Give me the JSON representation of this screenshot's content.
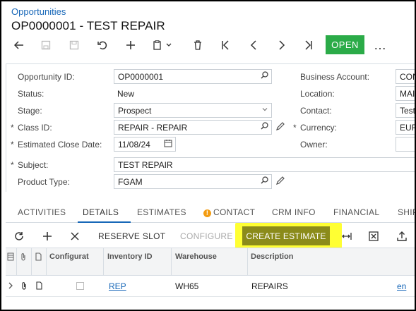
{
  "breadcrumb": "Opportunities",
  "title": "OP0000001 - TEST REPAIR",
  "toolbar": {
    "open_label": "OPEN",
    "more_label": "…"
  },
  "form": {
    "left": [
      {
        "label": "Opportunity ID:",
        "value": "OP0000001"
      },
      {
        "label": "Status:",
        "value": "New"
      },
      {
        "label": "Stage:",
        "value": "Prospect"
      },
      {
        "label": "Class ID:",
        "value": "REPAIR - REPAIR"
      },
      {
        "label": "Estimated Close Date:",
        "value": "11/08/24"
      },
      {
        "label": "Subject:",
        "value": "TEST REPAIR"
      },
      {
        "label": "Product Type:",
        "value": "FGAM"
      }
    ],
    "right": [
      {
        "label": "Business Account:",
        "value": "CON"
      },
      {
        "label": "Location:",
        "value": "MAIN"
      },
      {
        "label": "Contact:",
        "value": "Test"
      },
      {
        "label": "Currency:",
        "value": "EUR"
      },
      {
        "label": "Owner:",
        "value": ""
      }
    ],
    "required_mark": "*"
  },
  "tabs": [
    "ACTIVITIES",
    "DETAILS",
    "ESTIMATES",
    "CONTACT",
    "CRM INFO",
    "FINANCIAL",
    "SHIP"
  ],
  "active_tab": "DETAILS",
  "warning_glyph": "!",
  "gridbar": {
    "reserve_slot": "RESERVE SLOT",
    "configure": "CONFIGURE",
    "create_estimate": "CREATE ESTIMATE"
  },
  "grid": {
    "columns": [
      "Configurat",
      "Inventory ID",
      "Warehouse",
      "Description"
    ],
    "rows": [
      {
        "inventory_id": "REP",
        "warehouse": "WH65",
        "description": "REPAIRS",
        "extra": "en"
      }
    ]
  },
  "colors": {
    "accent": "#1767b8",
    "open_button": "#2bab48",
    "highlight": "#ffff33",
    "create_estimate_button": "#8b8b1a"
  }
}
